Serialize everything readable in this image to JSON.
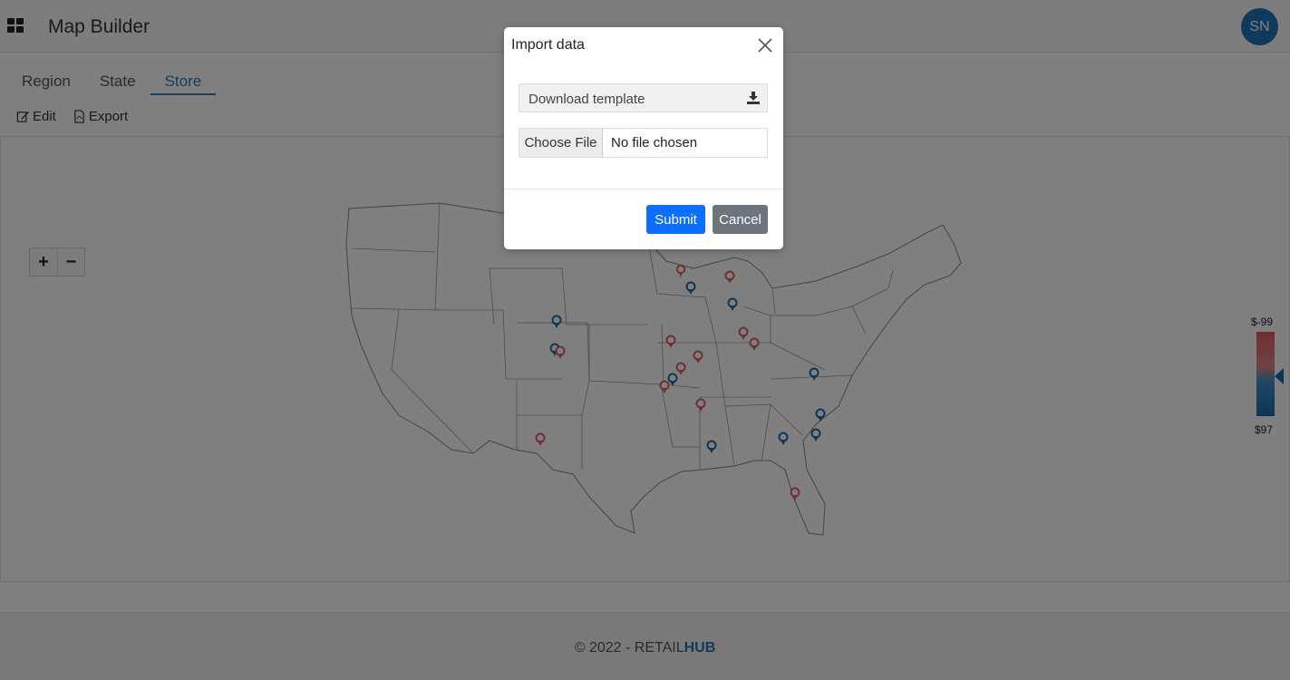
{
  "header": {
    "app_title": "Map Builder",
    "avatar_initials": "SN",
    "menu_icon": "grid-icon"
  },
  "tabs": [
    {
      "label": "Region"
    },
    {
      "label": "State"
    },
    {
      "label": "Store",
      "active": true
    }
  ],
  "toolbar": {
    "edit_label": "Edit",
    "export_label": "Export"
  },
  "map": {
    "zoom_in": "+",
    "zoom_out": "−",
    "legend": {
      "max_label": "$-99",
      "min_label": "$97"
    }
  },
  "footer": {
    "copyright_prefix": "© 2022 - RETAIL",
    "copyright_brand": "HUB"
  },
  "modal": {
    "title": "Import data",
    "download_label": "Download template",
    "choose_file_label": "Choose File",
    "file_status": "No file chosen",
    "submit_label": "Submit",
    "cancel_label": "Cancel"
  },
  "colors": {
    "accent": "#1f74b8",
    "primary_button": "#0d6efd",
    "secondary_button": "#6c757d",
    "positive_marker": "#e25b63",
    "negative_marker": "#1b6aa8"
  }
}
